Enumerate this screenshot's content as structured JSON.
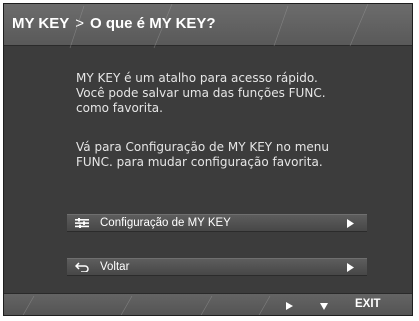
{
  "header": {
    "parent": "MY KEY",
    "separator": ">",
    "title": "O que é MY KEY?"
  },
  "body": {
    "paragraph1": "MY KEY é um atalho para acesso rápido.\nVocê pode salvar uma das funções FUNC.\ncomo favorita.",
    "paragraph2": "Vá para Configuração de MY KEY no menu\nFUNC. para mudar configuração favorita."
  },
  "menu": {
    "items": [
      {
        "label": "Configuração de MY KEY",
        "icon": "settings-sliders-icon"
      },
      {
        "label": "Voltar",
        "icon": "back-arrow-icon"
      }
    ]
  },
  "footer": {
    "right_icon": "play-right-icon",
    "down_icon": "triangle-down-icon",
    "exit_label": "EXIT"
  },
  "colors": {
    "panel": "#3c3c3c",
    "titlebar": "#646464",
    "text": "#e6e6e6"
  }
}
